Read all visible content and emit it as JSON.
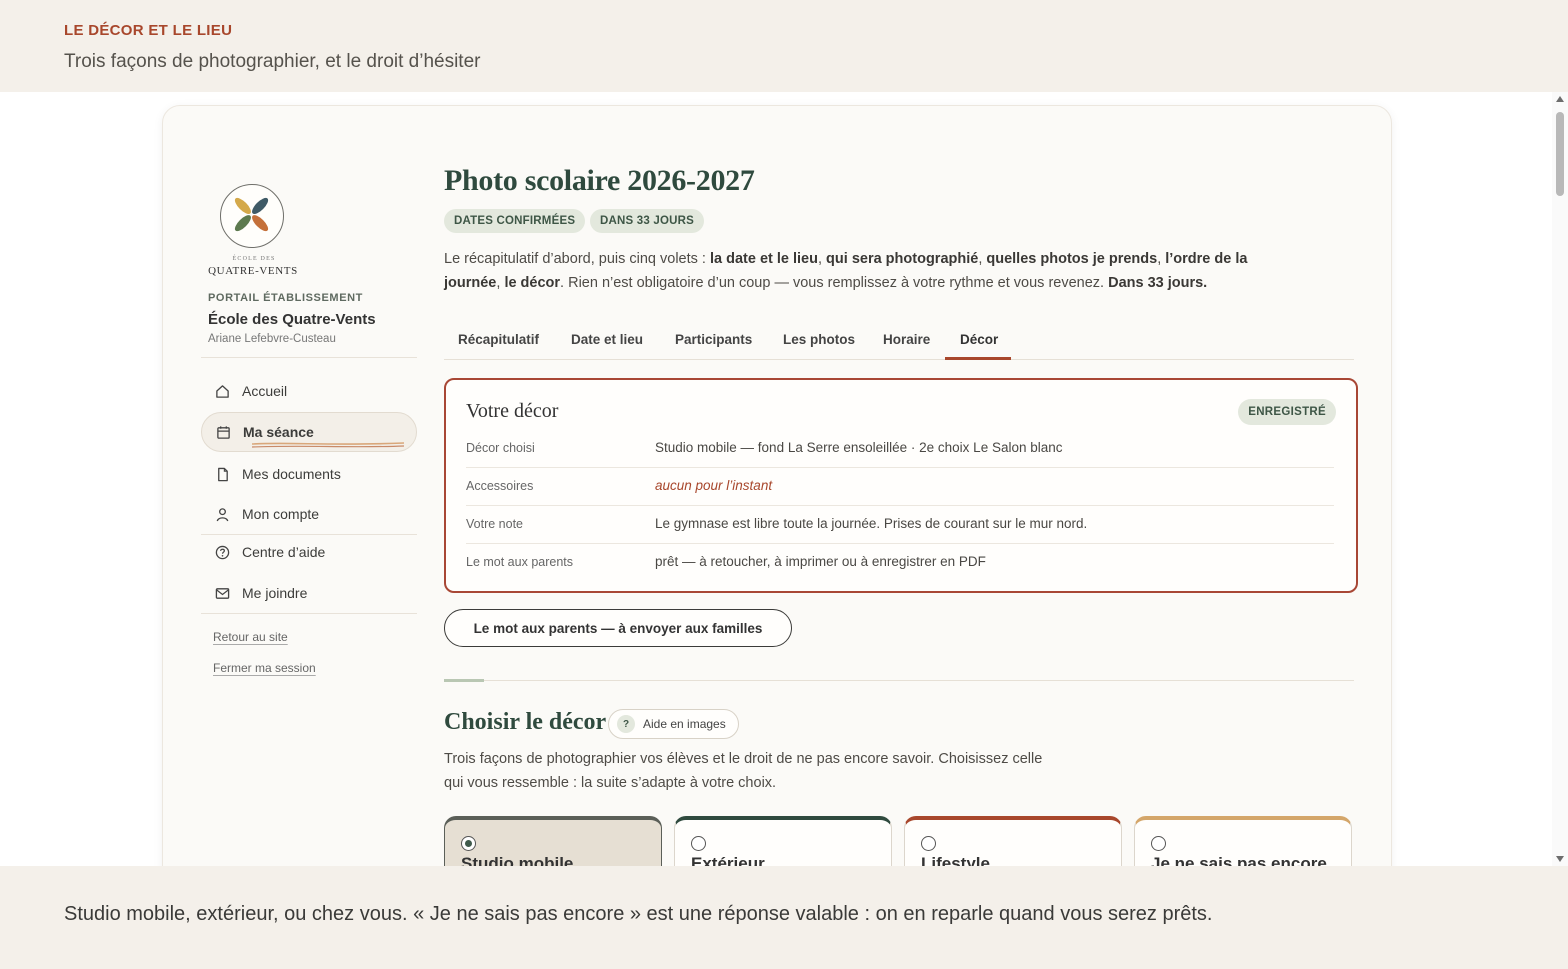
{
  "banner": {
    "eyebrow": "LE DÉCOR ET LE LIEU",
    "subtitle": "Trois façons de photographier, et le droit d’hésiter"
  },
  "sidebar": {
    "logo_small": "ÉCOLE DES",
    "logo_name": "QUATRE-VENTS",
    "portal_label": "PORTAIL ÉTABLISSEMENT",
    "school_name": "École des Quatre-Vents",
    "user_name": "Ariane Lefebvre-Custeau",
    "items": [
      {
        "label": "Accueil",
        "icon": "home-icon"
      },
      {
        "label": "Ma séance",
        "icon": "calendar-icon",
        "active": true
      },
      {
        "label": "Mes documents",
        "icon": "document-icon"
      },
      {
        "label": "Mon compte",
        "icon": "user-icon"
      },
      {
        "label": "Centre d’aide",
        "icon": "help-circle-icon"
      },
      {
        "label": "Me joindre",
        "icon": "mail-icon"
      }
    ],
    "links": [
      "Retour au site",
      "Fermer ma session"
    ]
  },
  "main": {
    "title": "Photo scolaire 2026-2027",
    "badges": [
      "DATES CONFIRMÉES",
      "DANS 33 JOURS"
    ],
    "intro": {
      "p1": "Le récapitulatif d’abord, puis cinq volets : ",
      "b1": "la date et le lieu",
      "s1": ", ",
      "b2": "qui sera photographié",
      "s2": ", ",
      "b3": "quelles photos je prends",
      "s3": ", ",
      "b4": "l’ordre de la journée",
      "s4": ", ",
      "b5": "le décor",
      "p2": ". Rien n’est obligatoire d’un coup — vous remplissez à votre rythme et vous revenez. ",
      "b6": "Dans 33 jours."
    },
    "tabs": [
      "Récapitulatif",
      "Date et lieu",
      "Participants",
      "Les photos",
      "Horaire",
      "Décor"
    ],
    "active_tab": "Décor",
    "decor_box": {
      "title": "Votre décor",
      "status": "ENREGISTRÉ",
      "rows": [
        {
          "key": "Décor choisi",
          "value": "Studio mobile — fond La Serre ensoleillée · 2e choix Le Salon blanc"
        },
        {
          "key": "Accessoires",
          "value": "aucun pour l’instant"
        },
        {
          "key": "Votre note",
          "value": "Le gymnase est libre toute la journée. Prises de courant sur le mur nord."
        },
        {
          "key": "Le mot aux parents",
          "value": "prêt — à retoucher, à imprimer ou à enregistrer en PDF"
        }
      ]
    },
    "parents_button": "Le mot aux parents — à envoyer aux familles",
    "section": {
      "title": "Choisir le décor",
      "help_icon": "?",
      "help_label": "Aide en images",
      "desc_line1": "Trois façons de photographier vos élèves et le droit de ne pas encore savoir. Choisissez celle",
      "desc_line2": "qui vous ressemble : la suite s’adapte à votre choix."
    },
    "choices": [
      {
        "label": "Studio mobile",
        "selected": true,
        "accent": "#5b5f58"
      },
      {
        "label": "Extérieur",
        "selected": false,
        "accent": "#2f4a3e"
      },
      {
        "label": "Lifestyle",
        "selected": false,
        "accent": "#a8472c"
      },
      {
        "label": "Je ne sais pas encore",
        "selected": false,
        "accent": "#d4a66a"
      }
    ]
  },
  "footer": {
    "text": "Studio mobile, extérieur, ou chez vous. « Je ne sais pas encore » est une réponse valable : on en reparle quand vous serez prêts."
  },
  "colors": {
    "accent": "#a8472c",
    "green": "#2f4a3e",
    "badge_bg": "#e3e8dd"
  }
}
